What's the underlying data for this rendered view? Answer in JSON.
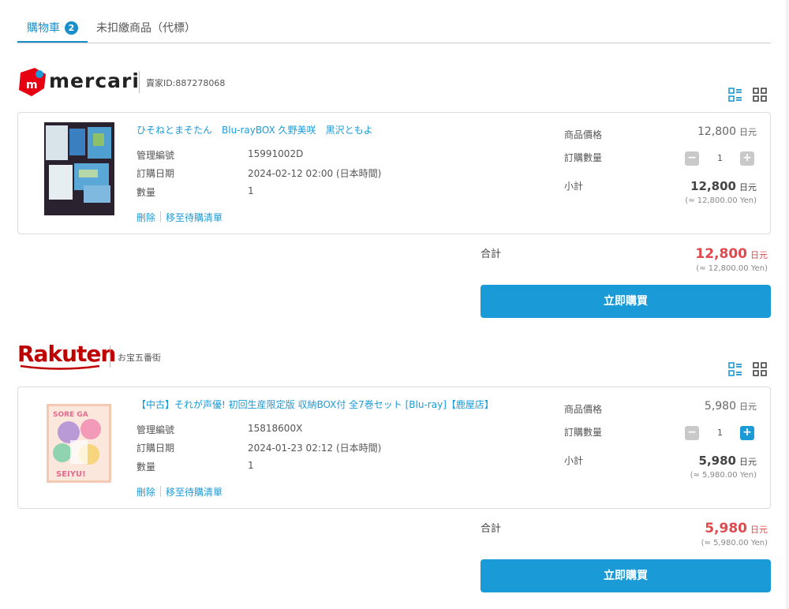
{
  "tabs": [
    {
      "label": "購物車",
      "count": "2"
    },
    {
      "label": "未扣繳商品（代標）"
    }
  ],
  "stores": [
    {
      "name": "mercari",
      "seller_text": "賣家ID:887278068",
      "item": {
        "title": "ひそねとまそたん　Blu-rayBOX 久野美咲　黒沢ともよ",
        "meta": [
          {
            "label": "管理編號",
            "value": "15991002D"
          },
          {
            "label": "訂購日期",
            "value": "2024-02-12 02:00 (日本時間)"
          },
          {
            "label": "數量",
            "value": "1"
          }
        ],
        "delete_label": "刪除",
        "wishlist_label": "移至待購清單",
        "price_label": "商品價格",
        "price": "12,800",
        "qty_label": "訂購數量",
        "qty": "1",
        "subtotal_label": "小計",
        "subtotal": "12,800",
        "subtotal_yen": "(≈ 12,800.00 Yen)"
      },
      "total_label": "合計",
      "total": "12,800",
      "total_yen": "(≈ 12,800.00 Yen)",
      "buy_label": "立即購買"
    },
    {
      "name": "Rakuten",
      "seller_text": "お宝五番街",
      "item": {
        "title": "【中古】それが声優! 初回生産限定版 収納BOX付 全7巻セット [Blu-ray]【鹿屋店】",
        "meta": [
          {
            "label": "管理編號",
            "value": "15818600X"
          },
          {
            "label": "訂購日期",
            "value": "2024-01-23 02:12 (日本時間)"
          },
          {
            "label": "數量",
            "value": "1"
          }
        ],
        "delete_label": "刪除",
        "wishlist_label": "移至待購清單",
        "price_label": "商品價格",
        "price": "5,980",
        "qty_label": "訂購數量",
        "qty": "1",
        "subtotal_label": "小計",
        "subtotal": "5,980",
        "subtotal_yen": "(≈ 5,980.00 Yen)"
      },
      "total_label": "合計",
      "total": "5,980",
      "total_yen": "(≈ 5,980.00 Yen)",
      "buy_label": "立即購買"
    }
  ],
  "currency_unit": "日元",
  "icons": {
    "list_view": "list-view-icon",
    "grid_view": "grid-view-icon"
  },
  "colors": {
    "accent": "#1a9bd7",
    "total_red": "#e0494d",
    "rakuten_red": "#bf0000",
    "mercari_red": "#e60012"
  }
}
